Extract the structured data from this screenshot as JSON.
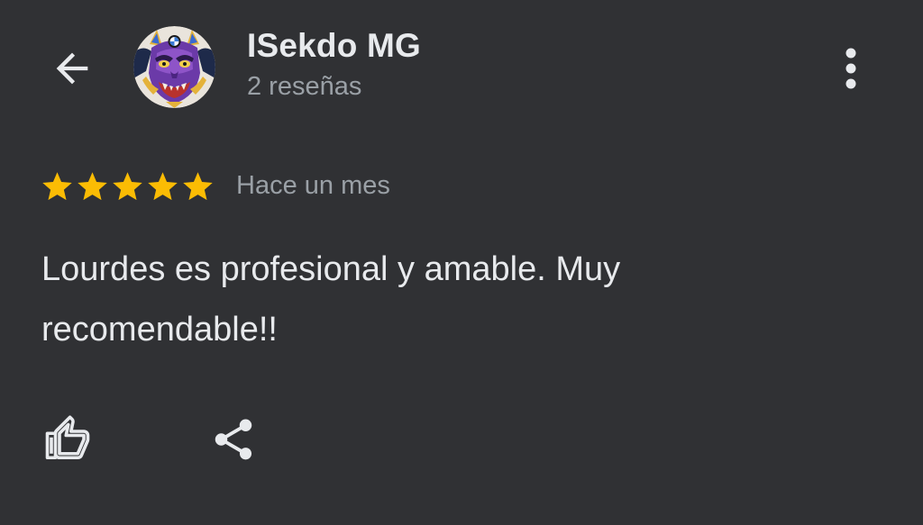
{
  "reviewer": {
    "name": "ISekdo MG",
    "review_count": "2 reseñas"
  },
  "review": {
    "rating": 5,
    "rating_max": 5,
    "date": "Hace un mes",
    "text": "Lourdes es profesional y amable. Muy recomendable!!"
  },
  "icons": {
    "back": "arrow-back-icon",
    "more": "more-vert-icon",
    "star": "star-icon",
    "like": "thumb-up-icon",
    "share": "share-icon"
  },
  "colors": {
    "background": "#303134",
    "primary_text": "#e8eaed",
    "secondary_text": "#9aa0a6",
    "star": "#fbbc04"
  }
}
